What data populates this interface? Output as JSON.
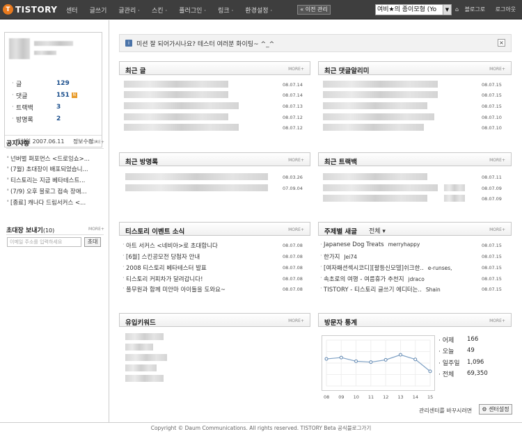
{
  "header": {
    "logo_text": "TISTORY",
    "logo_mark": "T",
    "nav": [
      "센터",
      "글쓰기",
      "글관리 ·",
      "스킨 ·",
      "플러그인 ·",
      "링크 ·",
      "환경설정 ·"
    ],
    "prev_admin": "« 이전 관리",
    "blog_select": "여비★의 종이모형 (Yo",
    "blog_link": "블로그로",
    "logout": "로그아웃"
  },
  "sidebar": {
    "stats": [
      {
        "label": "글",
        "value": "129"
      },
      {
        "label": "댓글",
        "value": "151",
        "badge": "N"
      },
      {
        "label": "트랙백",
        "value": "3"
      },
      {
        "label": "방명록",
        "value": "2"
      }
    ],
    "opened": "개설일 2007.06.11",
    "edit_info": "정보수정 ›",
    "notice_title": "공지사항",
    "more": "MORE+",
    "notices": [
      "' 넌버벌 퍼포먼스 <드로잉쇼>...",
      "' (7월) 초대장이 배포되었습니...",
      "' 티스토리는 지금 베타테스트...",
      "' (7/9) 오후 블로그 접속 장애...",
      "' [종료] 캐나다 드림서커스 <..."
    ],
    "invite_title": "초대장 보내기",
    "invite_count": "(10)",
    "email_placeholder": "이메일 주소를 입력하세요",
    "send_label": "초대"
  },
  "main": {
    "alert_text": "미션 잘 되어가시나요? 테스터 여러분 화이팅~ ^_^",
    "alert_close": "×",
    "more": "MORE+",
    "recent_posts": {
      "title": "최근 글",
      "dates": [
        "08.07.14",
        "08.07.14",
        "08.07.13",
        "08.07.12",
        "08.07.12"
      ]
    },
    "recent_comments": {
      "title": "최근 댓글알리미",
      "dates": [
        "08.07.15",
        "08.07.15",
        "08.07.15",
        "08.07.10",
        "08.07.10"
      ]
    },
    "recent_guestbook": {
      "title": "최근 방명록",
      "dates": [
        "08.03.26",
        "07.09.04"
      ]
    },
    "recent_trackbacks": {
      "title": "최근 트랙백",
      "dates": [
        "08.07.11",
        "08.07.09",
        "08.07.09"
      ]
    },
    "events": {
      "title": "티스토리 이벤트 소식",
      "items": [
        {
          "text": "아트 서커스 <네비아>로 초대합니다",
          "date": "08.07.08"
        },
        {
          "text": "[6월] 스킨공모전 당첨자 안내",
          "date": "08.07.08"
        },
        {
          "text": "2008 티스토리 베타테스터 발표",
          "date": "08.07.08"
        },
        {
          "text": "티스토리 커피차가 달려갑니다!",
          "date": "08.07.08"
        },
        {
          "text": "풀무원과 함께 미안마 아이들을 도와요~",
          "date": "08.07.08"
        }
      ]
    },
    "topics": {
      "title": "주제별 새글",
      "dropdown": "전체 ▾",
      "items": [
        {
          "text": "Japanese Dog Treats",
          "author": "merryhappy",
          "date": "08.07.15"
        },
        {
          "text": "한가지",
          "author": "Jei74",
          "date": "08.07.15"
        },
        {
          "text": "[여자패션섹시코디][팔등신모델]쉬크한..",
          "author": "e-runses,",
          "date": "08.07.15"
        },
        {
          "text": "속초로의 여행 - 여름휴가 추천지",
          "author": "jdraco",
          "date": "08.07.15"
        },
        {
          "text": "TISTORY - 티스토리 글쓰기 에디터는..",
          "author": "Shain",
          "date": "08.07.15"
        }
      ]
    },
    "keywords": {
      "title": "유입키워드"
    },
    "visitors": {
      "title": "방문자 통계",
      "rows": [
        {
          "label": "어제",
          "value": "166"
        },
        {
          "label": "오늘",
          "value": "49"
        },
        {
          "label": "일주일",
          "value": "1,096"
        },
        {
          "label": "전체",
          "value": "69,350"
        }
      ]
    },
    "footer_note": "관리센터를 바꾸시려면",
    "center_settings": "⚙ 센터설정"
  },
  "chart_data": {
    "type": "line",
    "categories": [
      "08",
      "09",
      "10",
      "11",
      "12",
      "13",
      "14",
      "15"
    ],
    "values": [
      59,
      62,
      54,
      52,
      57,
      68,
      58,
      32
    ],
    "ylim": [
      0,
      100
    ],
    "grid": true,
    "colors": {
      "line": "#7da0c4",
      "point": "#5f86b0"
    }
  },
  "footer": "Copyright © Daum Communications. All rights reserved. TISTORY Beta 공식블로그가기"
}
